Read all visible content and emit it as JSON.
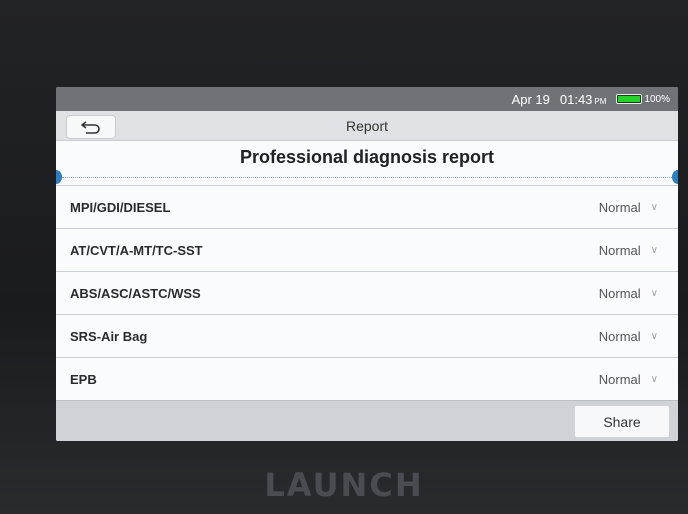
{
  "status": {
    "date": "Apr 19",
    "time": "01:43",
    "ampm": "PM",
    "battery": "100%",
    "battery_level": 1.0,
    "battery_color": "#25d22a"
  },
  "header": {
    "title": "Report",
    "back_icon": "undo-arrow-icon"
  },
  "report": {
    "title": "Professional diagnosis report",
    "rows": [
      {
        "label": "MPI/GDI/DIESEL",
        "status": "Normal"
      },
      {
        "label": "AT/CVT/A-MT/TC-SST",
        "status": "Normal"
      },
      {
        "label": "ABS/ASC/ASTC/WSS",
        "status": "Normal"
      },
      {
        "label": "SRS-Air Bag",
        "status": "Normal"
      },
      {
        "label": "EPB",
        "status": "Normal"
      }
    ]
  },
  "footer": {
    "share_label": "Share"
  },
  "device": {
    "brand": "LAUNCH"
  }
}
